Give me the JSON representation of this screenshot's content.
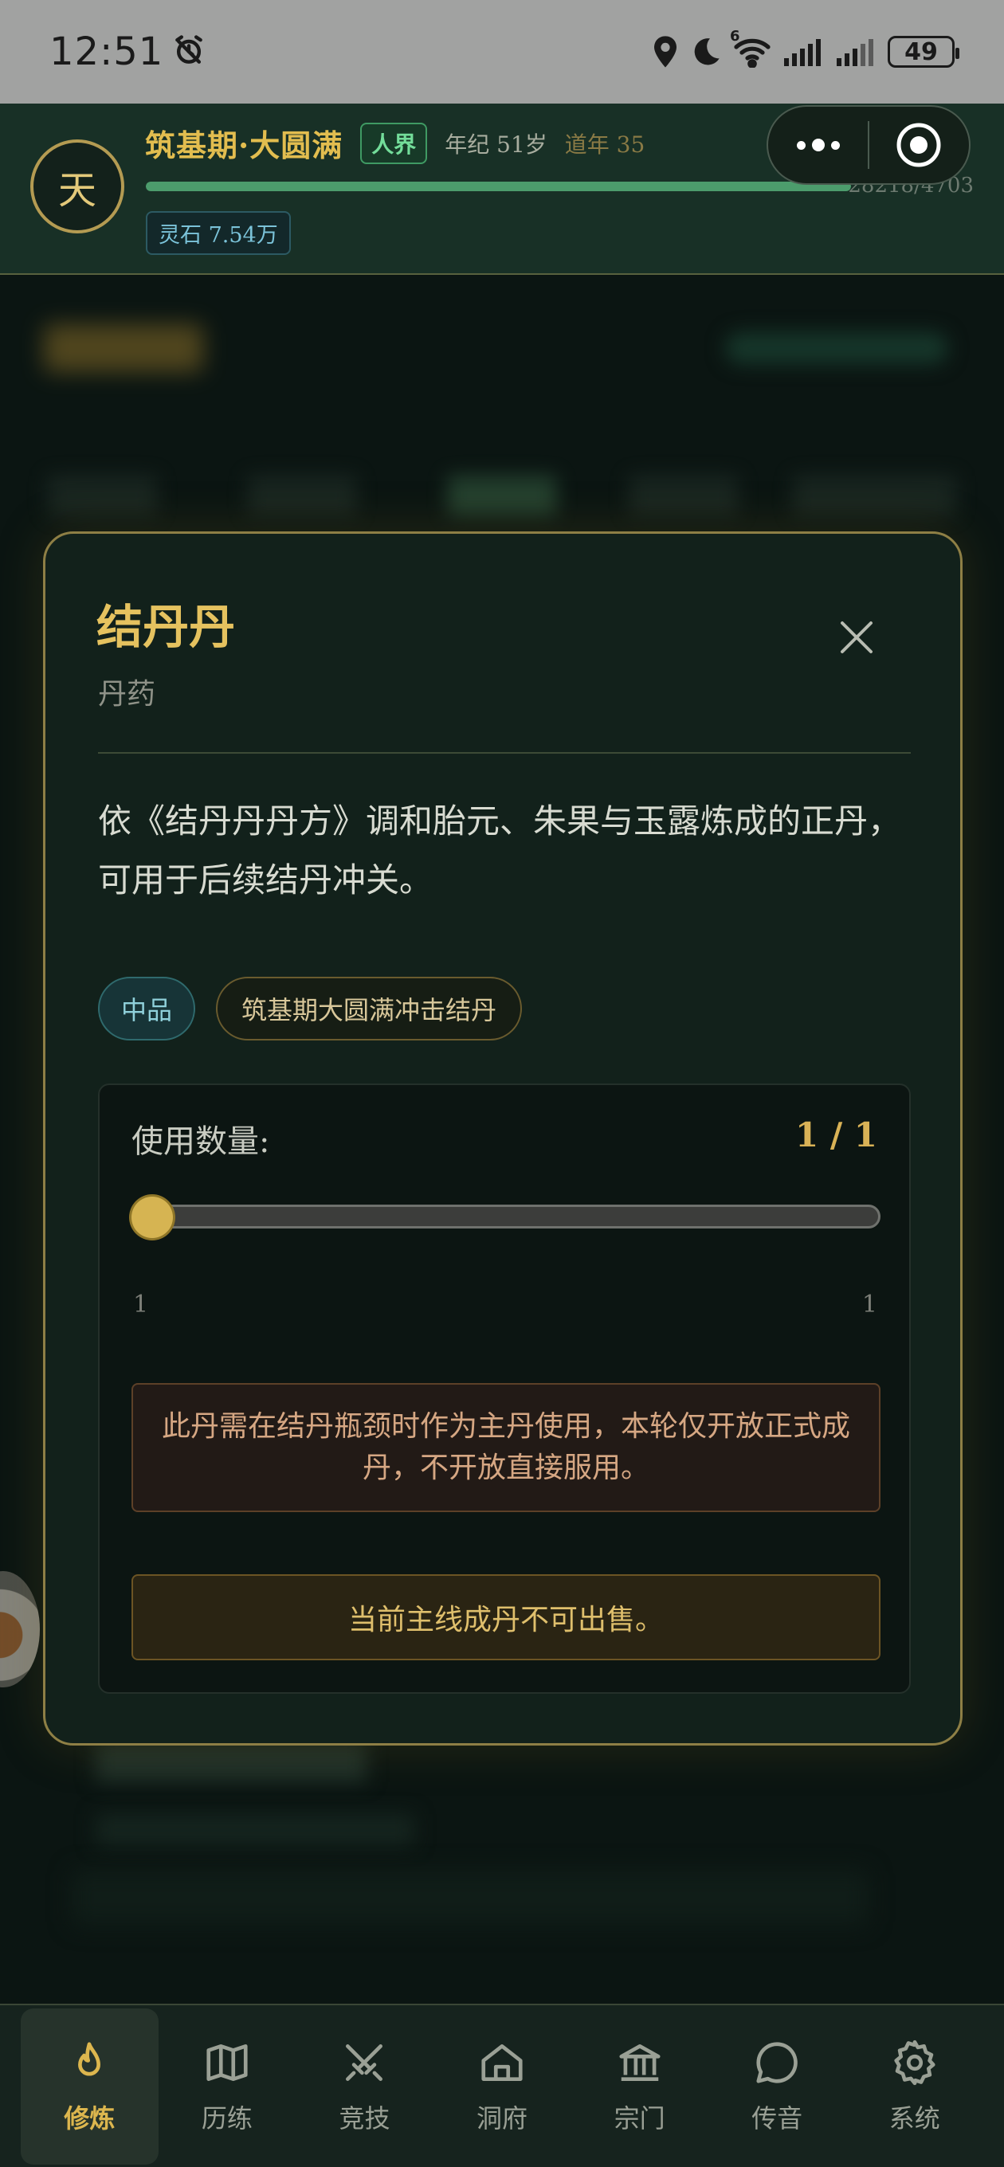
{
  "status_bar": {
    "time": "12:51",
    "battery": "49",
    "signal_badge": "6"
  },
  "header": {
    "avatar_char": "天",
    "realm": "筑基期·大圆满",
    "world_badge": "人界",
    "age": "年纪 51岁",
    "dao_year": "道年 35",
    "exp_text": "28218/4703",
    "exp_progress": 1.0,
    "spirit_stone": "灵石 7.54万"
  },
  "modal": {
    "title": "结丹丹",
    "subtitle": "丹药",
    "description": "依《结丹丹丹方》调和胎元、朱果与玉露炼成的正丹，可用于后续结丹冲关。",
    "tags": {
      "grade": "中品",
      "stage": "筑基期大圆满冲击结丹"
    },
    "use": {
      "label": "使用数量:",
      "count": "1 / 1",
      "min": "1",
      "max": "1",
      "value": 1
    },
    "warning": "此丹需在结丹瓶颈时作为主丹使用，本轮仅开放正式成丹，不开放直接服用。",
    "sell_notice": "当前主线成丹不可出售。"
  },
  "bottom_nav": {
    "items": [
      {
        "label": "修炼",
        "icon": "flame-icon",
        "active": true
      },
      {
        "label": "历练",
        "icon": "map-icon",
        "active": false
      },
      {
        "label": "竞技",
        "icon": "crossed-swords-icon",
        "active": false
      },
      {
        "label": "洞府",
        "icon": "home-icon",
        "active": false
      },
      {
        "label": "宗门",
        "icon": "temple-icon",
        "active": false
      },
      {
        "label": "传音",
        "icon": "chat-bubble-icon",
        "active": false
      },
      {
        "label": "系统",
        "icon": "gear-icon",
        "active": false
      }
    ]
  },
  "colors": {
    "accent_gold": "#e2bd4f",
    "header_bg": "#183026",
    "modal_bg": "#12211b",
    "modal_border": "#8e7f45",
    "progress": "#4c9c6c",
    "badge_green": "#73dd9a"
  }
}
